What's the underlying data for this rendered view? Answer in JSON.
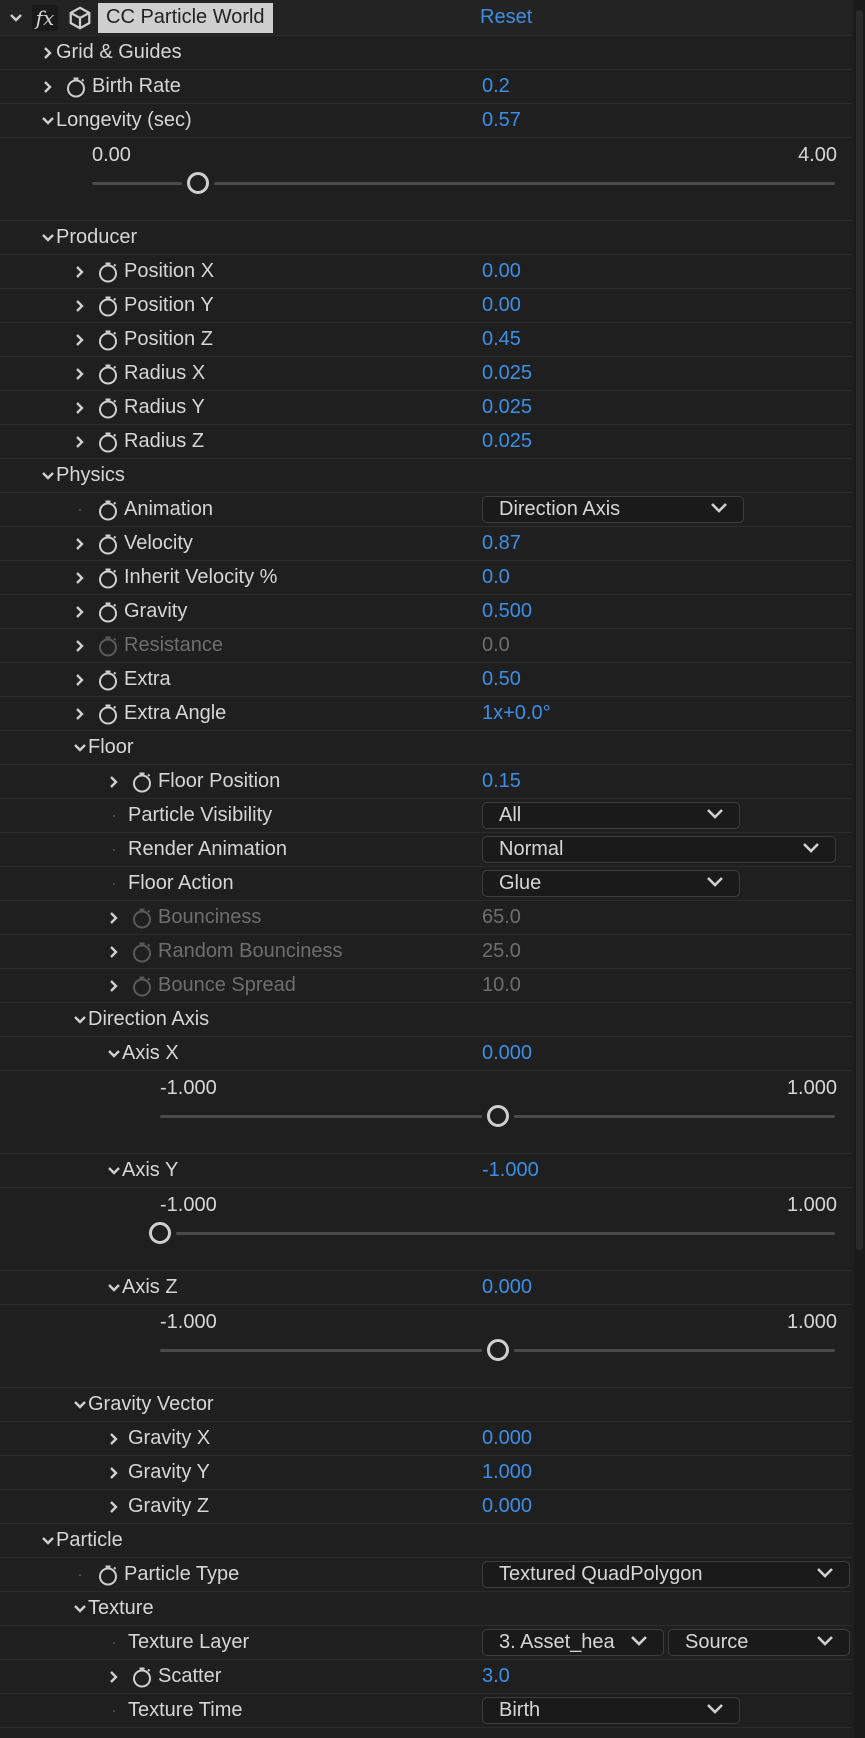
{
  "effect": {
    "name": "CC Particle World",
    "fx_label": "fx",
    "reset_label": "Reset"
  },
  "rows": {
    "grid_guides": {
      "label": "Grid & Guides"
    },
    "birth_rate": {
      "label": "Birth Rate",
      "value": "0.2"
    },
    "longevity": {
      "label": "Longevity (sec)",
      "value": "0.57",
      "min": "0.00",
      "max": "4.00",
      "position": 0.1425
    },
    "producer": {
      "label": "Producer"
    },
    "position_x": {
      "label": "Position X",
      "value": "0.00"
    },
    "position_y": {
      "label": "Position Y",
      "value": "0.00"
    },
    "position_z": {
      "label": "Position Z",
      "value": "0.45"
    },
    "radius_x": {
      "label": "Radius X",
      "value": "0.025"
    },
    "radius_y": {
      "label": "Radius Y",
      "value": "0.025"
    },
    "radius_z": {
      "label": "Radius Z",
      "value": "0.025"
    },
    "physics": {
      "label": "Physics"
    },
    "animation": {
      "label": "Animation",
      "value": "Direction Axis"
    },
    "velocity": {
      "label": "Velocity",
      "value": "0.87"
    },
    "inherit_velocity": {
      "label": "Inherit Velocity %",
      "value": "0.0"
    },
    "gravity": {
      "label": "Gravity",
      "value": "0.500"
    },
    "resistance": {
      "label": "Resistance",
      "value": "0.0"
    },
    "extra": {
      "label": "Extra",
      "value": "0.50"
    },
    "extra_angle": {
      "label": "Extra Angle",
      "value": "1x+0.0°"
    },
    "floor": {
      "label": "Floor"
    },
    "floor_position": {
      "label": "Floor Position",
      "value": "0.15"
    },
    "particle_visibility": {
      "label": "Particle Visibility",
      "value": "All"
    },
    "render_animation": {
      "label": "Render Animation",
      "value": "Normal"
    },
    "floor_action": {
      "label": "Floor Action",
      "value": "Glue"
    },
    "bounciness": {
      "label": "Bounciness",
      "value": "65.0"
    },
    "random_bounciness": {
      "label": "Random Bounciness",
      "value": "25.0"
    },
    "bounce_spread": {
      "label": "Bounce Spread",
      "value": "10.0"
    },
    "direction_axis": {
      "label": "Direction Axis"
    },
    "axis_x": {
      "label": "Axis X",
      "value": "0.000",
      "min": "-1.000",
      "max": "1.000",
      "position": 0.5
    },
    "axis_y": {
      "label": "Axis Y",
      "value": "-1.000",
      "min": "-1.000",
      "max": "1.000",
      "position": 0.0
    },
    "axis_z": {
      "label": "Axis Z",
      "value": "0.000",
      "min": "-1.000",
      "max": "1.000",
      "position": 0.5
    },
    "gravity_vector": {
      "label": "Gravity Vector"
    },
    "gravity_x": {
      "label": "Gravity X",
      "value": "0.000"
    },
    "gravity_y": {
      "label": "Gravity Y",
      "value": "1.000"
    },
    "gravity_z": {
      "label": "Gravity Z",
      "value": "0.000"
    },
    "particle": {
      "label": "Particle"
    },
    "particle_type": {
      "label": "Particle Type",
      "value": "Textured QuadPolygon"
    },
    "texture": {
      "label": "Texture"
    },
    "texture_layer": {
      "label": "Texture Layer",
      "value": "3. Asset_hea",
      "value2": "Source"
    },
    "scatter": {
      "label": "Scatter",
      "value": "3.0"
    },
    "texture_time": {
      "label": "Texture Time",
      "value": "Birth"
    }
  },
  "colors": {
    "accent": "#3c8fe6",
    "background": "#1f1f1f",
    "text": "#d6d6d6",
    "disabled": "#6e6e6e"
  }
}
